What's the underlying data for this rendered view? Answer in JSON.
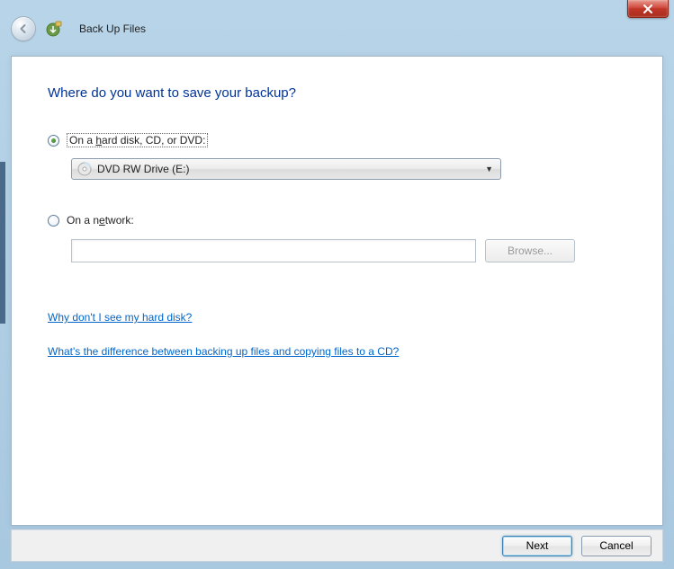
{
  "header": {
    "title": "Back Up Files"
  },
  "main": {
    "heading": "Where do you want to save your backup?",
    "option_disk": {
      "label_pre": "On a ",
      "label_underline": "h",
      "label_post": "ard disk, CD, or DVD:",
      "selected": true,
      "drive": "DVD RW Drive (E:)"
    },
    "option_network": {
      "label_pre": "On a n",
      "label_underline": "e",
      "label_post": "twork:",
      "path": "",
      "browse": "Browse..."
    },
    "links": {
      "hard_disk": "Why don't I see my hard disk?",
      "difference": "What's the difference between backing up files and copying files to a CD?"
    }
  },
  "footer": {
    "next": "Next",
    "cancel": "Cancel"
  }
}
